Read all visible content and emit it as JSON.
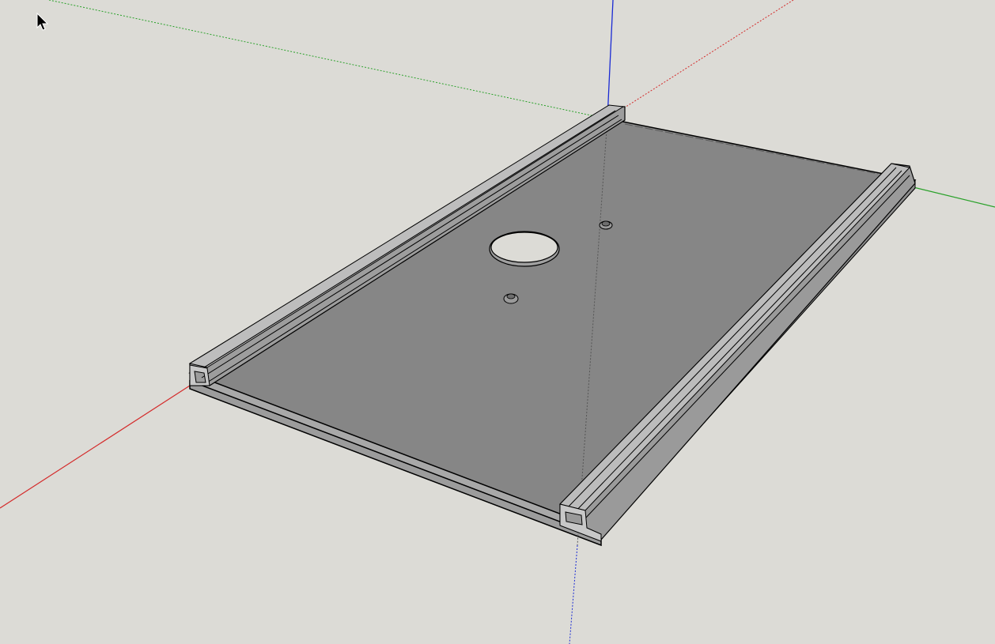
{
  "app": {
    "view": "3d-modeling-viewport",
    "tool": "select",
    "cursor_icon": "arrow-cursor-icon"
  },
  "colors": {
    "background": "#dcdbd6",
    "x_axis": "#d42a2a",
    "y_axis": "#2aa12a",
    "z_axis": "#1a2ad4",
    "plate_top": "#868686",
    "plate_side": "#a7a7a7",
    "rail_top": "#b4b4b4",
    "edge": "#000000"
  },
  "model": {
    "object": "router-plate",
    "features": [
      "center-hole-icon",
      "screw-hole-icon",
      "t-track-rail-icon"
    ],
    "rail_count": 2,
    "screw_hole_count": 2,
    "center_hole_count": 1
  }
}
